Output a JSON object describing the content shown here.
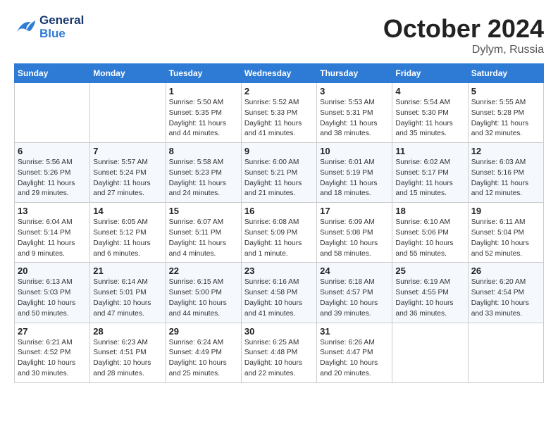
{
  "header": {
    "logo_line1": "General",
    "logo_line2": "Blue",
    "month": "October 2024",
    "location": "Dylym, Russia"
  },
  "weekdays": [
    "Sunday",
    "Monday",
    "Tuesday",
    "Wednesday",
    "Thursday",
    "Friday",
    "Saturday"
  ],
  "weeks": [
    [
      {
        "day": "",
        "info": ""
      },
      {
        "day": "",
        "info": ""
      },
      {
        "day": "1",
        "info": "Sunrise: 5:50 AM\nSunset: 5:35 PM\nDaylight: 11 hours and 44 minutes."
      },
      {
        "day": "2",
        "info": "Sunrise: 5:52 AM\nSunset: 5:33 PM\nDaylight: 11 hours and 41 minutes."
      },
      {
        "day": "3",
        "info": "Sunrise: 5:53 AM\nSunset: 5:31 PM\nDaylight: 11 hours and 38 minutes."
      },
      {
        "day": "4",
        "info": "Sunrise: 5:54 AM\nSunset: 5:30 PM\nDaylight: 11 hours and 35 minutes."
      },
      {
        "day": "5",
        "info": "Sunrise: 5:55 AM\nSunset: 5:28 PM\nDaylight: 11 hours and 32 minutes."
      }
    ],
    [
      {
        "day": "6",
        "info": "Sunrise: 5:56 AM\nSunset: 5:26 PM\nDaylight: 11 hours and 29 minutes."
      },
      {
        "day": "7",
        "info": "Sunrise: 5:57 AM\nSunset: 5:24 PM\nDaylight: 11 hours and 27 minutes."
      },
      {
        "day": "8",
        "info": "Sunrise: 5:58 AM\nSunset: 5:23 PM\nDaylight: 11 hours and 24 minutes."
      },
      {
        "day": "9",
        "info": "Sunrise: 6:00 AM\nSunset: 5:21 PM\nDaylight: 11 hours and 21 minutes."
      },
      {
        "day": "10",
        "info": "Sunrise: 6:01 AM\nSunset: 5:19 PM\nDaylight: 11 hours and 18 minutes."
      },
      {
        "day": "11",
        "info": "Sunrise: 6:02 AM\nSunset: 5:17 PM\nDaylight: 11 hours and 15 minutes."
      },
      {
        "day": "12",
        "info": "Sunrise: 6:03 AM\nSunset: 5:16 PM\nDaylight: 11 hours and 12 minutes."
      }
    ],
    [
      {
        "day": "13",
        "info": "Sunrise: 6:04 AM\nSunset: 5:14 PM\nDaylight: 11 hours and 9 minutes."
      },
      {
        "day": "14",
        "info": "Sunrise: 6:05 AM\nSunset: 5:12 PM\nDaylight: 11 hours and 6 minutes."
      },
      {
        "day": "15",
        "info": "Sunrise: 6:07 AM\nSunset: 5:11 PM\nDaylight: 11 hours and 4 minutes."
      },
      {
        "day": "16",
        "info": "Sunrise: 6:08 AM\nSunset: 5:09 PM\nDaylight: 11 hours and 1 minute."
      },
      {
        "day": "17",
        "info": "Sunrise: 6:09 AM\nSunset: 5:08 PM\nDaylight: 10 hours and 58 minutes."
      },
      {
        "day": "18",
        "info": "Sunrise: 6:10 AM\nSunset: 5:06 PM\nDaylight: 10 hours and 55 minutes."
      },
      {
        "day": "19",
        "info": "Sunrise: 6:11 AM\nSunset: 5:04 PM\nDaylight: 10 hours and 52 minutes."
      }
    ],
    [
      {
        "day": "20",
        "info": "Sunrise: 6:13 AM\nSunset: 5:03 PM\nDaylight: 10 hours and 50 minutes."
      },
      {
        "day": "21",
        "info": "Sunrise: 6:14 AM\nSunset: 5:01 PM\nDaylight: 10 hours and 47 minutes."
      },
      {
        "day": "22",
        "info": "Sunrise: 6:15 AM\nSunset: 5:00 PM\nDaylight: 10 hours and 44 minutes."
      },
      {
        "day": "23",
        "info": "Sunrise: 6:16 AM\nSunset: 4:58 PM\nDaylight: 10 hours and 41 minutes."
      },
      {
        "day": "24",
        "info": "Sunrise: 6:18 AM\nSunset: 4:57 PM\nDaylight: 10 hours and 39 minutes."
      },
      {
        "day": "25",
        "info": "Sunrise: 6:19 AM\nSunset: 4:55 PM\nDaylight: 10 hours and 36 minutes."
      },
      {
        "day": "26",
        "info": "Sunrise: 6:20 AM\nSunset: 4:54 PM\nDaylight: 10 hours and 33 minutes."
      }
    ],
    [
      {
        "day": "27",
        "info": "Sunrise: 6:21 AM\nSunset: 4:52 PM\nDaylight: 10 hours and 30 minutes."
      },
      {
        "day": "28",
        "info": "Sunrise: 6:23 AM\nSunset: 4:51 PM\nDaylight: 10 hours and 28 minutes."
      },
      {
        "day": "29",
        "info": "Sunrise: 6:24 AM\nSunset: 4:49 PM\nDaylight: 10 hours and 25 minutes."
      },
      {
        "day": "30",
        "info": "Sunrise: 6:25 AM\nSunset: 4:48 PM\nDaylight: 10 hours and 22 minutes."
      },
      {
        "day": "31",
        "info": "Sunrise: 6:26 AM\nSunset: 4:47 PM\nDaylight: 10 hours and 20 minutes."
      },
      {
        "day": "",
        "info": ""
      },
      {
        "day": "",
        "info": ""
      }
    ]
  ]
}
